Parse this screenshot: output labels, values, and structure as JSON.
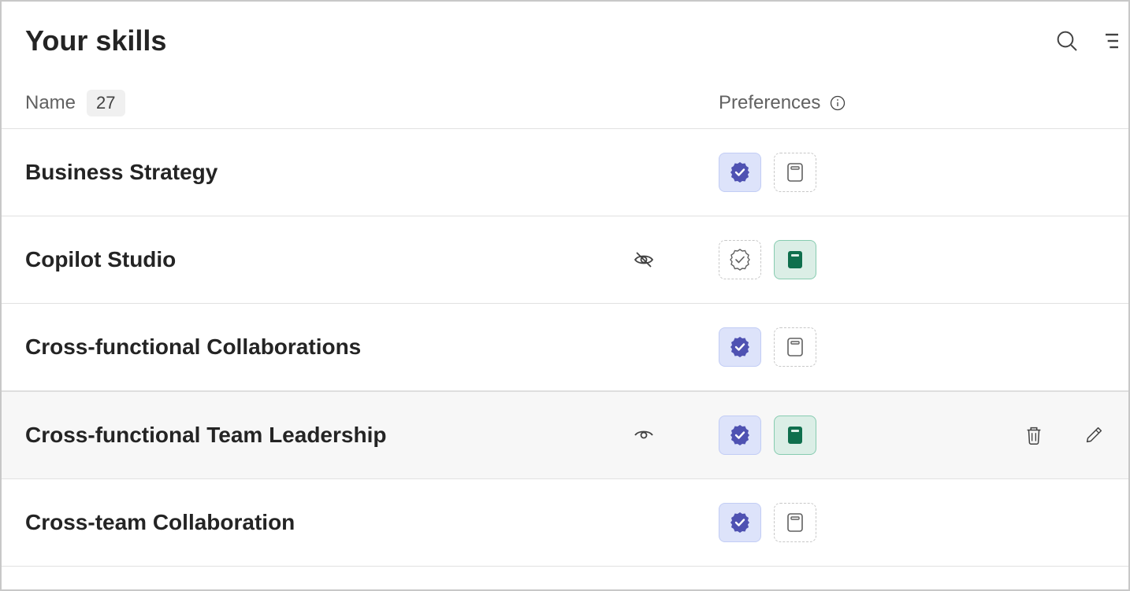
{
  "header": {
    "title": "Your skills"
  },
  "columns": {
    "name_label": "Name",
    "count": "27",
    "preferences_label": "Preferences"
  },
  "skills": [
    {
      "name": "Business Strategy",
      "visibility": null,
      "verified_active": true,
      "learn_active": false,
      "hovered": false
    },
    {
      "name": "Copilot Studio",
      "visibility": "hidden",
      "verified_active": false,
      "learn_active": true,
      "hovered": false
    },
    {
      "name": "Cross-functional Collaborations",
      "visibility": null,
      "verified_active": true,
      "learn_active": false,
      "hovered": false
    },
    {
      "name": "Cross-functional Team Leadership",
      "visibility": "visible",
      "verified_active": true,
      "learn_active": true,
      "hovered": true
    },
    {
      "name": "Cross-team Collaboration",
      "visibility": null,
      "verified_active": true,
      "learn_active": false,
      "hovered": false
    }
  ],
  "icons": {
    "search": "search-icon",
    "filter": "filter-icon",
    "info": "info-icon",
    "eye_hidden": "eye-hidden-icon",
    "eye_visible": "eye-visible-icon",
    "verified_seal": "verified-seal-icon",
    "book": "book-icon",
    "trash": "trash-icon",
    "pencil": "pencil-icon"
  },
  "colors": {
    "verified_bg": "#dde3fa",
    "verified_fill": "#4f52b2",
    "learn_bg": "#dbeee6",
    "learn_fill": "#0f6f4d",
    "neutral_border": "#c8c8c8"
  }
}
